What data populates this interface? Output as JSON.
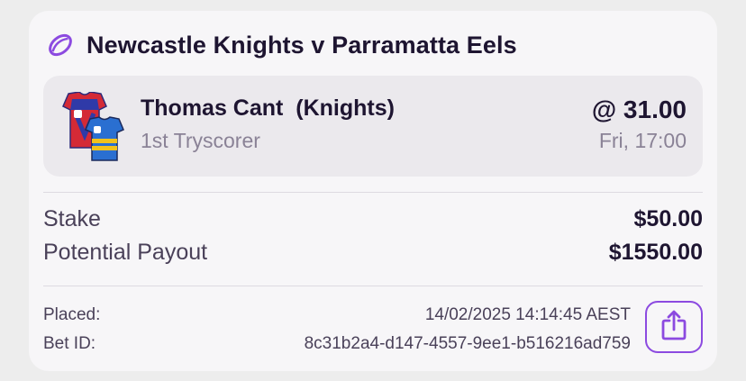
{
  "event": {
    "title": "Newcastle Knights v Parramatta Eels",
    "sport_icon": "rugby-ball-icon",
    "accent_color": "#8c4ae0"
  },
  "selection": {
    "name": "Thomas Cant  (Knights)",
    "market": "1st Tryscorer",
    "odds": "@ 31.00",
    "kickoff": "Fri, 17:00",
    "jersey_icons": [
      "knights-jersey-icon",
      "eels-jersey-icon"
    ]
  },
  "summary": {
    "stake_label": "Stake",
    "stake_value": "$50.00",
    "payout_label": "Potential Payout",
    "payout_value": "$1550.00"
  },
  "meta": {
    "placed_label": "Placed:",
    "placed_value": "14/02/2025 14:14:45 AEST",
    "betid_label": "Bet ID:",
    "betid_value": "8c31b2a4-d147-4557-9ee1-b516216ad759"
  },
  "actions": {
    "share_icon": "share-icon"
  }
}
